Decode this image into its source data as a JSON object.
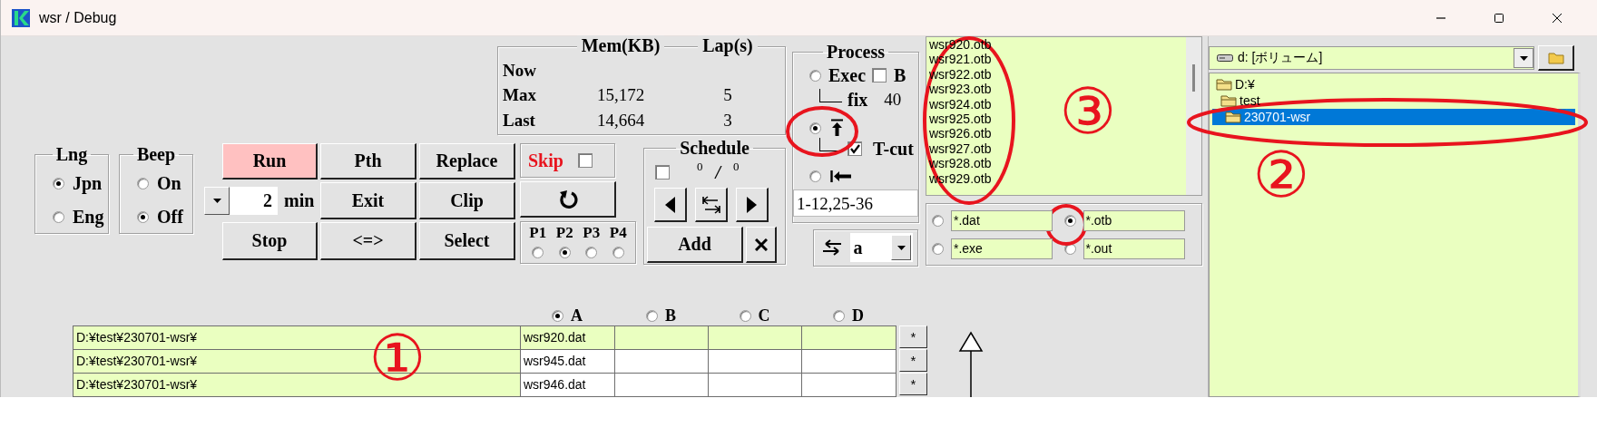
{
  "window": {
    "title": "wsr / Debug"
  },
  "language": {
    "title": "Lng",
    "options": [
      {
        "label": "Jpn",
        "selected": true
      },
      {
        "label": "Eng",
        "selected": false
      }
    ]
  },
  "beep": {
    "title": "Beep",
    "options": [
      {
        "label": "On",
        "selected": false
      },
      {
        "label": "Off",
        "selected": true
      }
    ]
  },
  "buttons": [
    {
      "label": "Run",
      "highlighted": true
    },
    {
      "label": "Pth",
      "highlighted": false
    },
    {
      "label": "Replace",
      "highlighted": false
    },
    {
      "label": "Exit",
      "highlighted": false
    },
    {
      "label": "Clip",
      "highlighted": false
    },
    {
      "label": "Stop",
      "highlighted": false
    },
    {
      "label": "<=>",
      "highlighted": false
    },
    {
      "label": "Select",
      "highlighted": false
    }
  ],
  "interval": {
    "value": "2",
    "unit": "min"
  },
  "memory": {
    "columns": [
      "Mem(KB)",
      "Lap(s)"
    ],
    "rows": [
      {
        "label": "Now"
      },
      {
        "label": "Max",
        "mem": "15,172",
        "lap": "5"
      },
      {
        "label": "Last",
        "mem": "14,664",
        "lap": "3"
      }
    ]
  },
  "skip": {
    "label": "Skip",
    "checked": false
  },
  "priority": {
    "options": [
      {
        "label": "P1",
        "selected": false
      },
      {
        "label": "P2",
        "selected": true
      },
      {
        "label": "P3",
        "selected": false
      },
      {
        "label": "P4",
        "selected": false
      }
    ]
  },
  "schedule": {
    "title": "Schedule",
    "checked": false,
    "current": "0",
    "separator": "/",
    "total": "0",
    "add_label": "Add"
  },
  "process": {
    "title": "Process",
    "modes": [
      {
        "kind": "exec",
        "label": "Exec",
        "selected": false
      },
      {
        "kind": "top",
        "selected": true
      },
      {
        "kind": "start",
        "selected": false
      }
    ],
    "b_option": {
      "label": "B",
      "checked": false
    },
    "fix": {
      "label": "fix",
      "value": "40"
    },
    "tcut": {
      "label": "T-cut",
      "checked": true
    },
    "range": "1-12,25-36"
  },
  "swap": {
    "value": "a"
  },
  "file_list": {
    "items": [
      "wsr920.otb",
      "wsr921.otb",
      "wsr922.otb",
      "wsr923.otb",
      "wsr924.otb",
      "wsr925.otb",
      "wsr926.otb",
      "wsr927.otb",
      "wsr928.otb",
      "wsr929.otb"
    ]
  },
  "filters": [
    {
      "pattern": "*.dat",
      "selected": false
    },
    {
      "pattern": "*.otb",
      "selected": true
    },
    {
      "pattern": "*.exe",
      "selected": false
    },
    {
      "pattern": "*.out",
      "selected": false
    }
  ],
  "drive": {
    "value": "d: [ボリューム]"
  },
  "folders": [
    {
      "name": "D:¥",
      "selected": false,
      "children": [
        {
          "name": "test",
          "selected": false,
          "children": [
            {
              "name": "230701-wsr",
              "selected": true
            }
          ]
        }
      ]
    }
  ],
  "slots": {
    "columns": [
      {
        "label": "A",
        "selected": true
      },
      {
        "label": "B",
        "selected": false
      },
      {
        "label": "C",
        "selected": false
      },
      {
        "label": "D",
        "selected": false
      }
    ],
    "rows": [
      {
        "path": "D:¥test¥230701-wsr¥",
        "file": "wsr920.dat",
        "selected": true,
        "action": "*"
      },
      {
        "path": "D:¥test¥230701-wsr¥",
        "file": "wsr945.dat",
        "selected": false,
        "action": "*"
      },
      {
        "path": "D:¥test¥230701-wsr¥",
        "file": "wsr946.dat",
        "selected": false,
        "action": "*"
      }
    ]
  },
  "annotations": [
    {
      "kind": "ellipse"
    },
    {
      "kind": "ellipse"
    },
    {
      "kind": "ellipse"
    },
    {
      "kind": "ellipse"
    },
    {
      "kind": "number",
      "text": "①"
    },
    {
      "kind": "number",
      "text": "②"
    },
    {
      "kind": "number",
      "text": "③"
    }
  ]
}
